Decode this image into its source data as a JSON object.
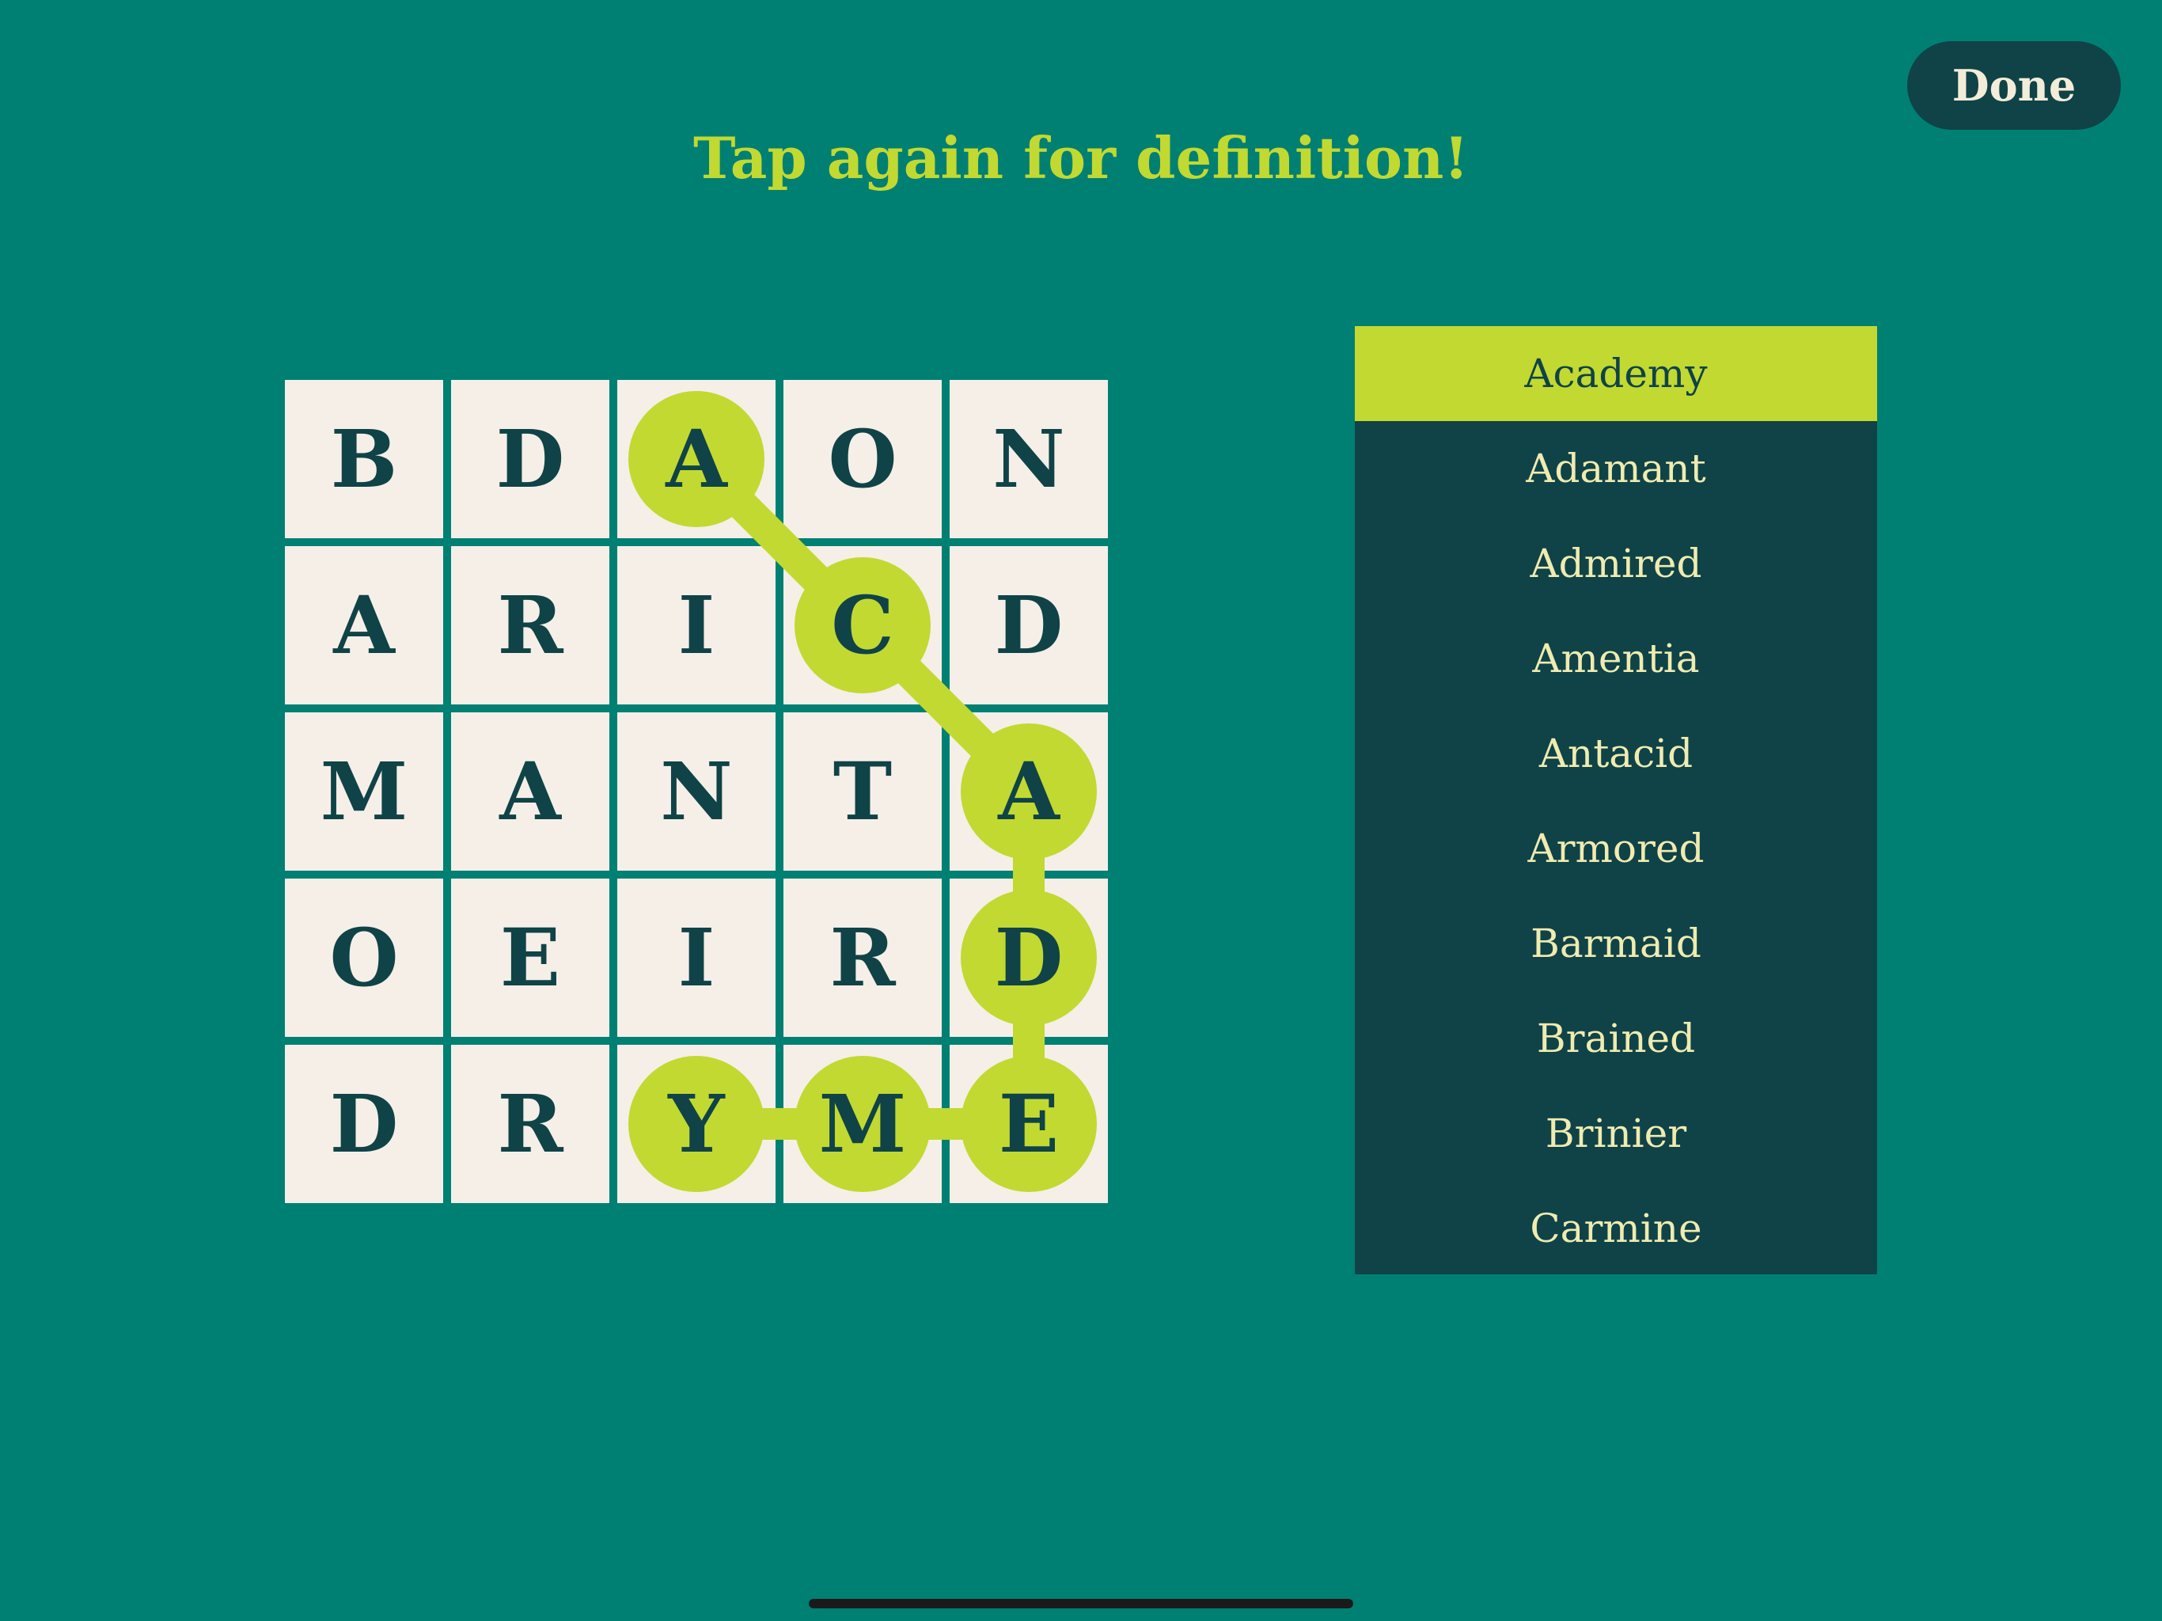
{
  "header": {
    "done_label": "Done",
    "instruction": "Tap again for definition!"
  },
  "board": {
    "rows": [
      [
        "B",
        "D",
        "A",
        "O",
        "N"
      ],
      [
        "A",
        "R",
        "I",
        "C",
        "D"
      ],
      [
        "M",
        "A",
        "N",
        "T",
        "A"
      ],
      [
        "O",
        "E",
        "I",
        "R",
        "D"
      ],
      [
        "D",
        "R",
        "Y",
        "M",
        "E"
      ]
    ],
    "selected_path": [
      [
        0,
        2
      ],
      [
        1,
        3
      ],
      [
        2,
        4
      ],
      [
        3,
        4
      ],
      [
        4,
        4
      ],
      [
        4,
        3
      ],
      [
        4,
        2
      ]
    ]
  },
  "word_list": {
    "selected_index": 0,
    "items": [
      "Academy",
      "Adamant",
      "Admired",
      "Amentia",
      "Antacid",
      "Armored",
      "Barmaid",
      "Brained",
      "Brinier",
      "Carmine"
    ]
  },
  "colors": {
    "background": "#008073",
    "tile": "#f5efe8",
    "letter": "#0f4347",
    "highlight": "#c2d931",
    "panel": "#0f4347",
    "list_text": "#f0ebb0"
  }
}
